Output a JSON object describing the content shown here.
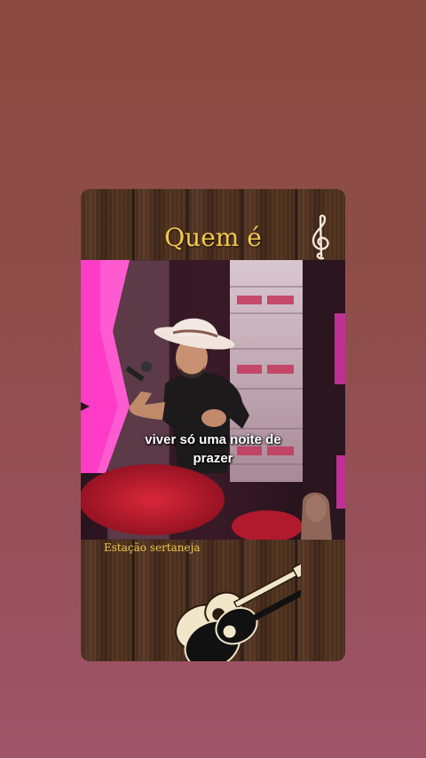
{
  "story": {
    "title": "Quem é",
    "caption_line1": "viver só uma noite de",
    "caption_line2": "prazer",
    "channel_label": "Estação sertaneja"
  },
  "icons": {
    "clef": "treble-clef-icon",
    "guitars": "guitars-icon"
  },
  "colors": {
    "background_top": "#8a4a40",
    "background_bottom": "#a0546a",
    "title_color": "#f2c94c",
    "stage_pink": "#ff3cc8"
  }
}
